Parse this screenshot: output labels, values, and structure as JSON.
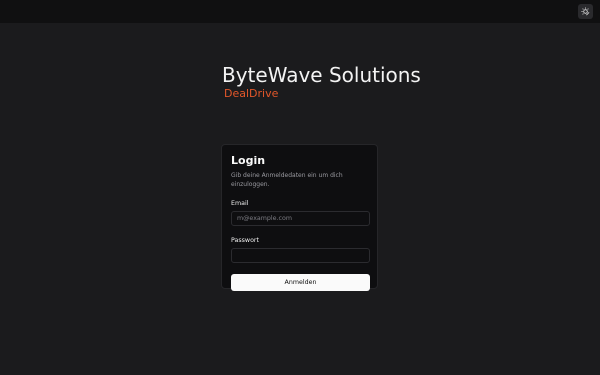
{
  "topbar": {
    "theme_toggle_icon": "sun-moon-icon"
  },
  "brand": {
    "title": "ByteWave Solutions",
    "subtitle": "DealDrive",
    "accent_color": "#e2572a"
  },
  "login": {
    "title": "Login",
    "description": "Gib deine Anmeldedaten ein um dich einzuloggen.",
    "email_label": "Email",
    "email_placeholder": "m@example.com",
    "email_value": "",
    "password_label": "Passwort",
    "password_value": "",
    "submit_label": "Anmelden"
  }
}
